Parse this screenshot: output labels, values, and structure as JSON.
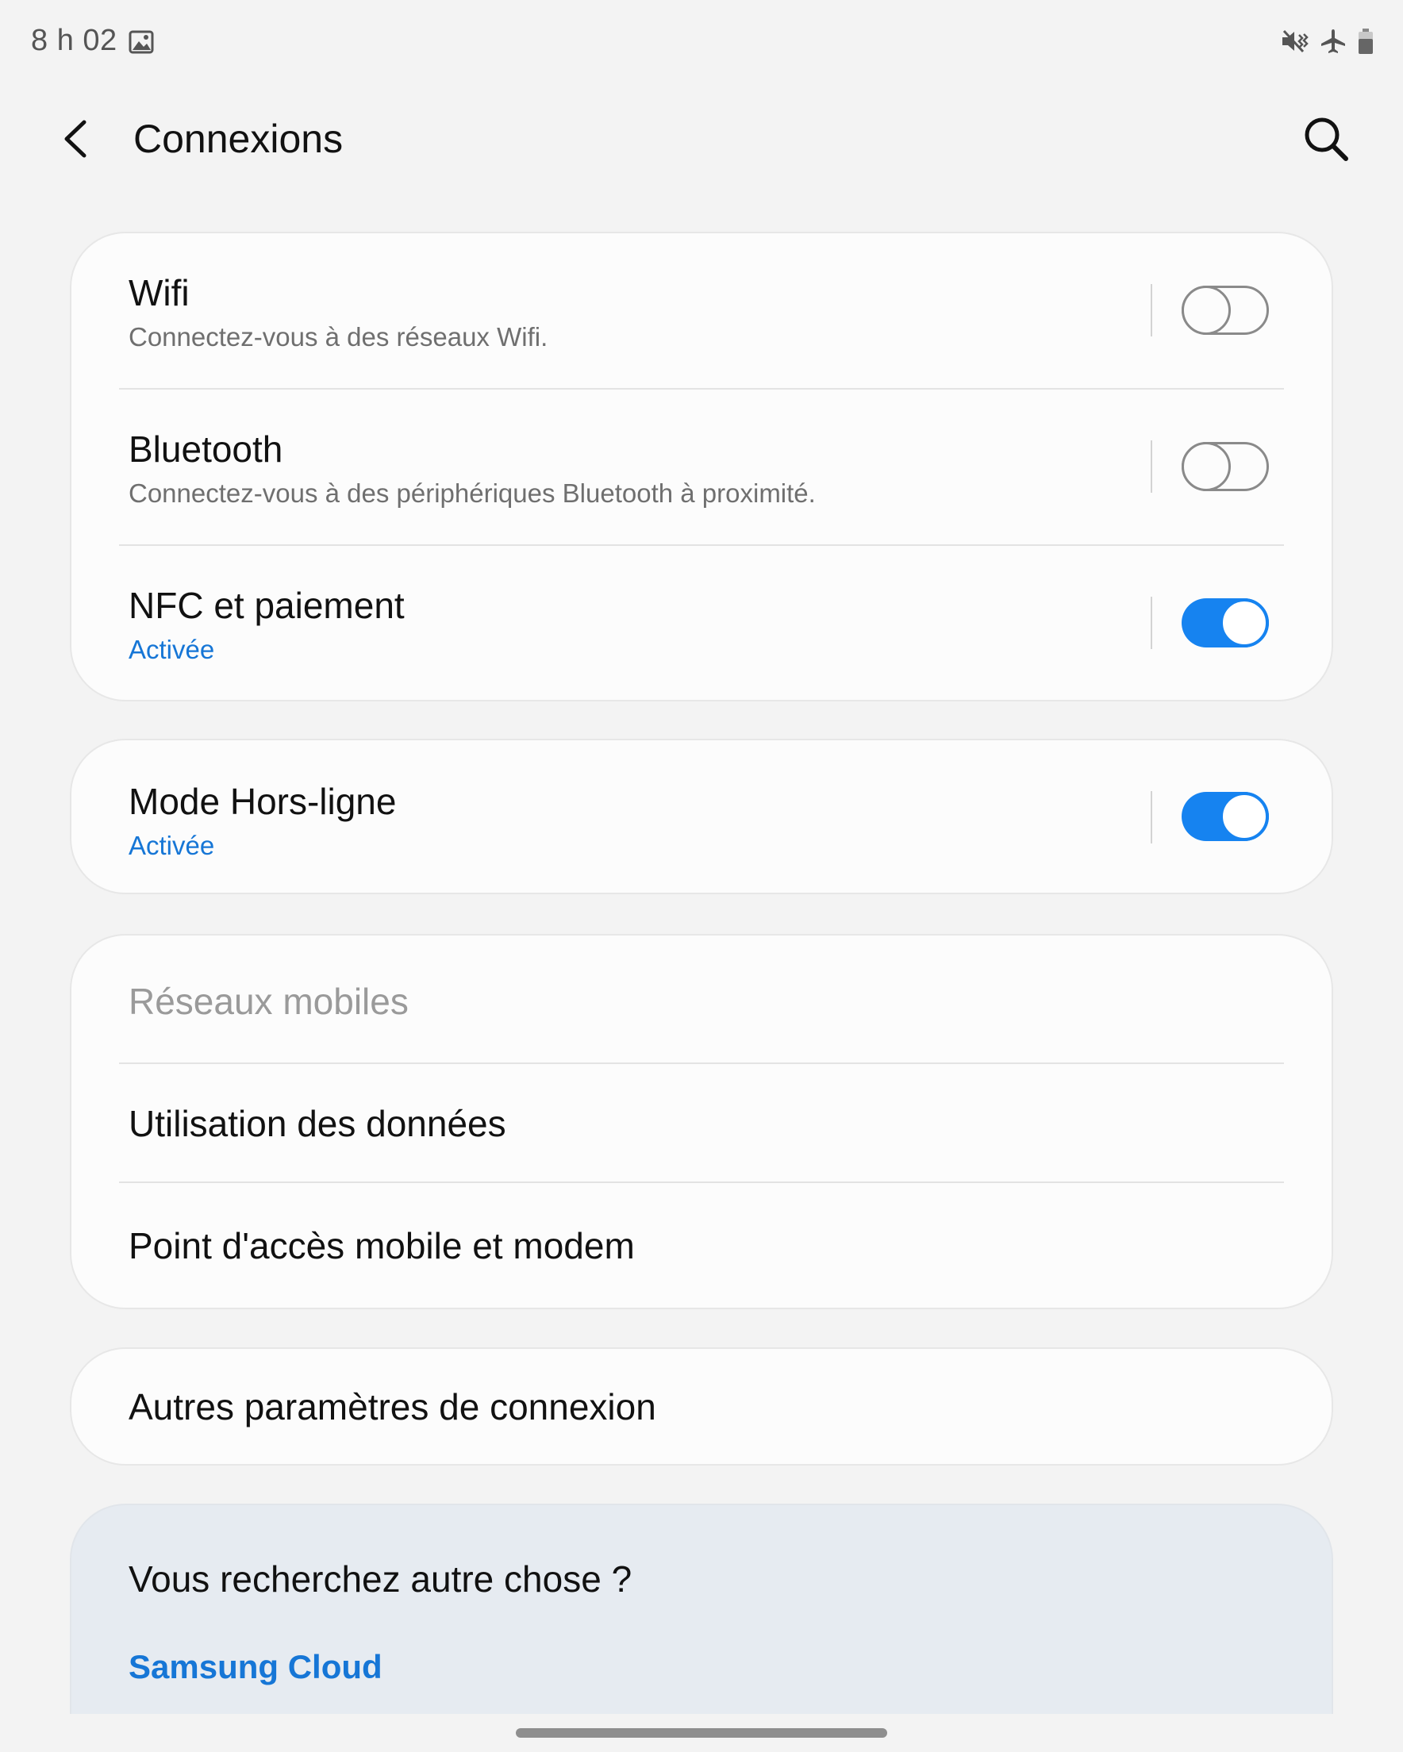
{
  "status_bar": {
    "time": "8 h 02",
    "left_icons": [
      "gallery-icon"
    ],
    "right_icons": [
      "mute-vibrate-icon",
      "airplane-icon",
      "battery-icon"
    ]
  },
  "header": {
    "back_icon": "chevron-left-icon",
    "title": "Connexions",
    "search_icon": "search-icon"
  },
  "groups": {
    "wireless": {
      "wifi": {
        "title": "Wifi",
        "subtitle": "Connectez-vous à des réseaux Wifi.",
        "enabled": false
      },
      "bluetooth": {
        "title": "Bluetooth",
        "subtitle": "Connectez-vous à des périphériques Bluetooth à proximité.",
        "enabled": false
      },
      "nfc": {
        "title": "NFC et paiement",
        "subtitle": "Activée",
        "enabled": true
      }
    },
    "offline": {
      "airplane": {
        "title": "Mode Hors-ligne",
        "subtitle": "Activée",
        "enabled": true
      }
    },
    "mobile": {
      "networks": {
        "title": "Réseaux mobiles"
      },
      "data_usage": {
        "title": "Utilisation des données"
      },
      "hotspot": {
        "title": "Point d'accès mobile et modem"
      }
    },
    "other": {
      "more": {
        "title": "Autres paramètres de connexion"
      }
    },
    "suggestions": {
      "heading": "Vous recherchez autre chose ?",
      "link": "Samsung Cloud"
    }
  },
  "colors": {
    "accent": "#1683f0",
    "active_text": "#1676d6",
    "background": "#f3f3f3",
    "card": "#fcfcfc",
    "suggestion_card": "#e6ebf1"
  }
}
